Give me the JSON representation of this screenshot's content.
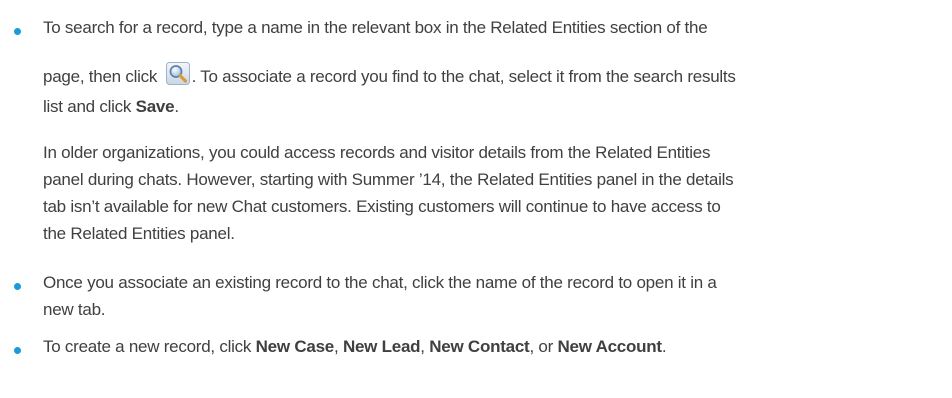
{
  "colors": {
    "text": "#404040",
    "bullet": "#1b9bd7"
  },
  "bullets": {
    "search": {
      "line1": "To search for a record, type a name in the relevant box in the Related Entities section of the",
      "line2_before_icon": "page, then click ",
      "icon": "lookup-magnifier-icon",
      "line2_after_icon": ". To associate a record you find to the chat, select it from the search results",
      "line3_prefix": "list and click ",
      "line3_bold": "Save",
      "line3_suffix": ".",
      "note_lines": [
        "In older organizations, you could access records and visitor details from the Related Entities",
        "panel during chats. However, starting with Summer ’14, the Related Entities panel in the details",
        "tab isn’t available for new Chat customers. Existing customers will continue to have access to",
        "the Related Entities panel."
      ]
    },
    "open_record": {
      "line1": "Once you associate an existing record to the chat, click the name of the record to open it in a",
      "line2": "new tab."
    },
    "create_record": {
      "prefix": "To create a new record, click ",
      "new_case": "New Case",
      "sep1": ", ",
      "new_lead": "New Lead",
      "sep2": ", ",
      "new_contact": "New Contact",
      "sep3": ", or ",
      "new_account": "New Account",
      "suffix": "."
    }
  }
}
